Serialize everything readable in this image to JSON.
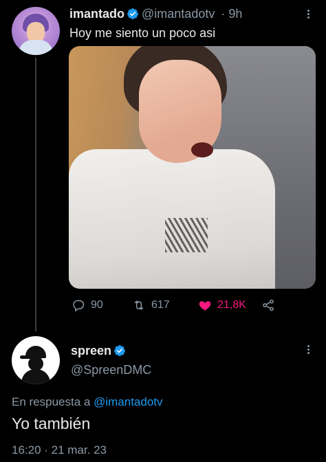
{
  "quoted_tweet": {
    "display_name": "imantado",
    "handle": "@imantadotv",
    "time": "9h",
    "text": "Hoy me siento un poco asi",
    "replies": "90",
    "retweets": "617",
    "likes": "21,8K",
    "like_color": "#f91880"
  },
  "main_tweet": {
    "display_name": "spreen",
    "handle": "@SpreenDMC",
    "reply_prefix": "En respuesta a",
    "reply_mention": "@imantadotv",
    "text": "Yo también",
    "timestamp": "16:20 · 21 mar. 23"
  },
  "colors": {
    "background": "#000000",
    "secondary_text": "#8b98a5",
    "link": "#1d9bf0",
    "verified": "#1d9bf0"
  },
  "icons": [
    "verified-badge-icon",
    "more-options-icon",
    "reply-icon",
    "retweet-icon",
    "heart-icon",
    "share-icon"
  ]
}
